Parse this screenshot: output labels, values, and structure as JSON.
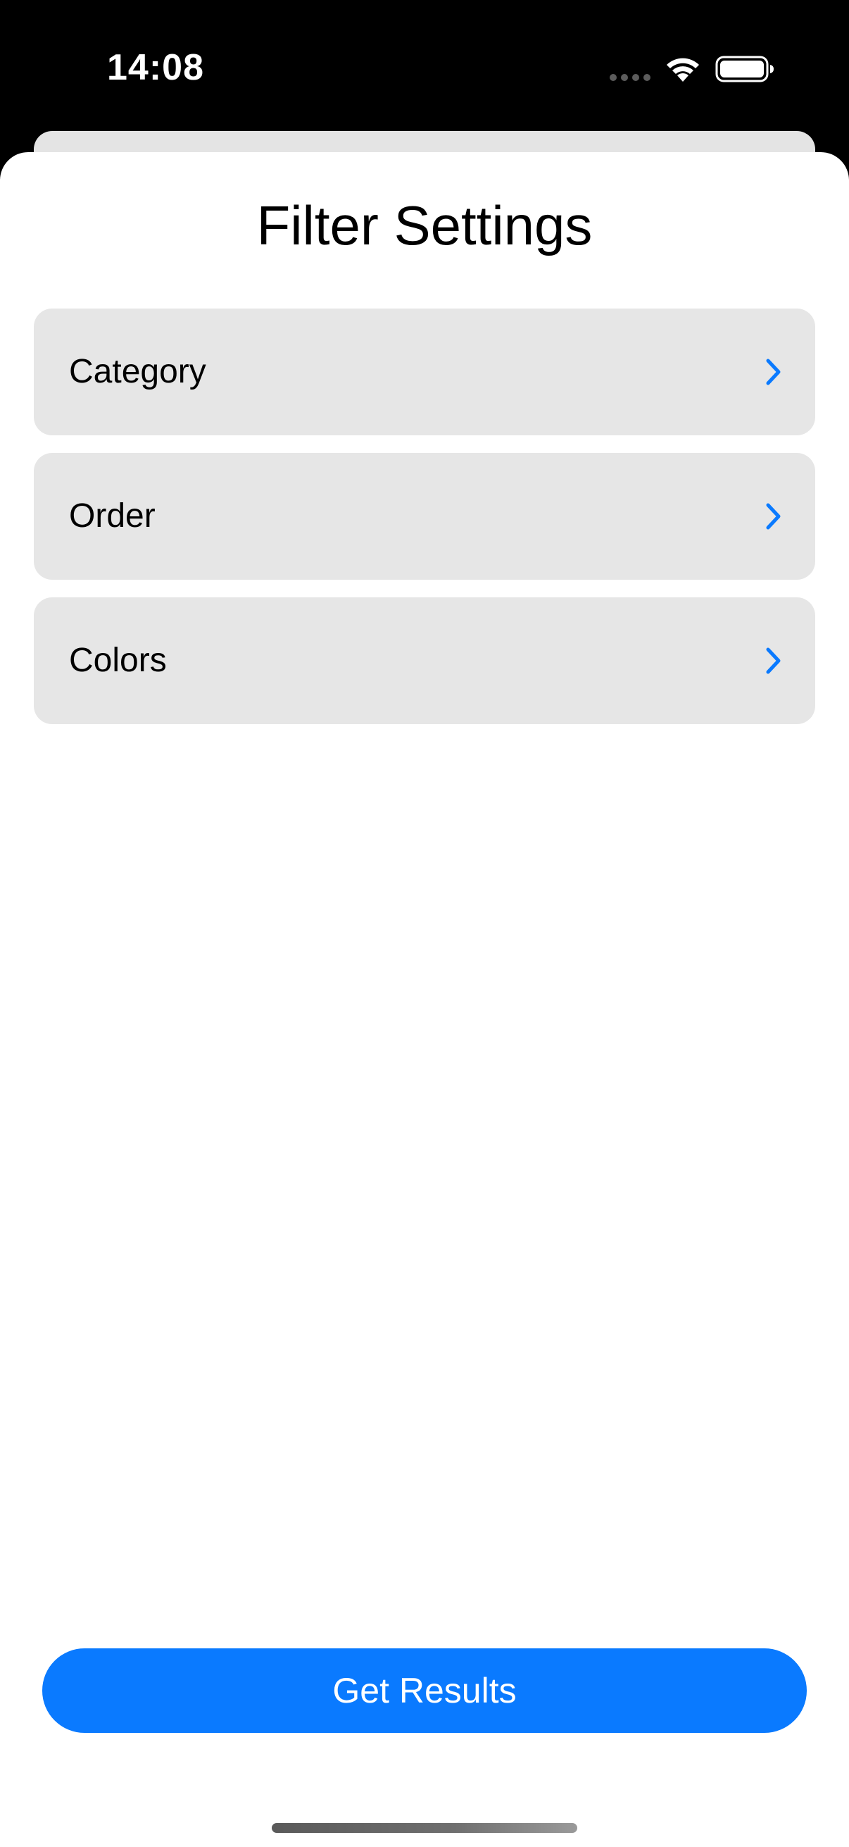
{
  "status_bar": {
    "time": "14:08"
  },
  "sheet": {
    "title": "Filter Settings",
    "rows": [
      {
        "label": "Category"
      },
      {
        "label": "Order"
      },
      {
        "label": "Colors"
      }
    ],
    "primary_button": {
      "label": "Get Results"
    }
  },
  "colors": {
    "accent": "#0a7aff",
    "row_background": "#e6e6e6",
    "background": "#000000",
    "sheet": "#ffffff"
  },
  "icons": {
    "row_chevron": "chevron-right-icon",
    "wifi": "wifi-icon",
    "battery": "battery-icon",
    "signal": "cellular-signal-icon"
  }
}
